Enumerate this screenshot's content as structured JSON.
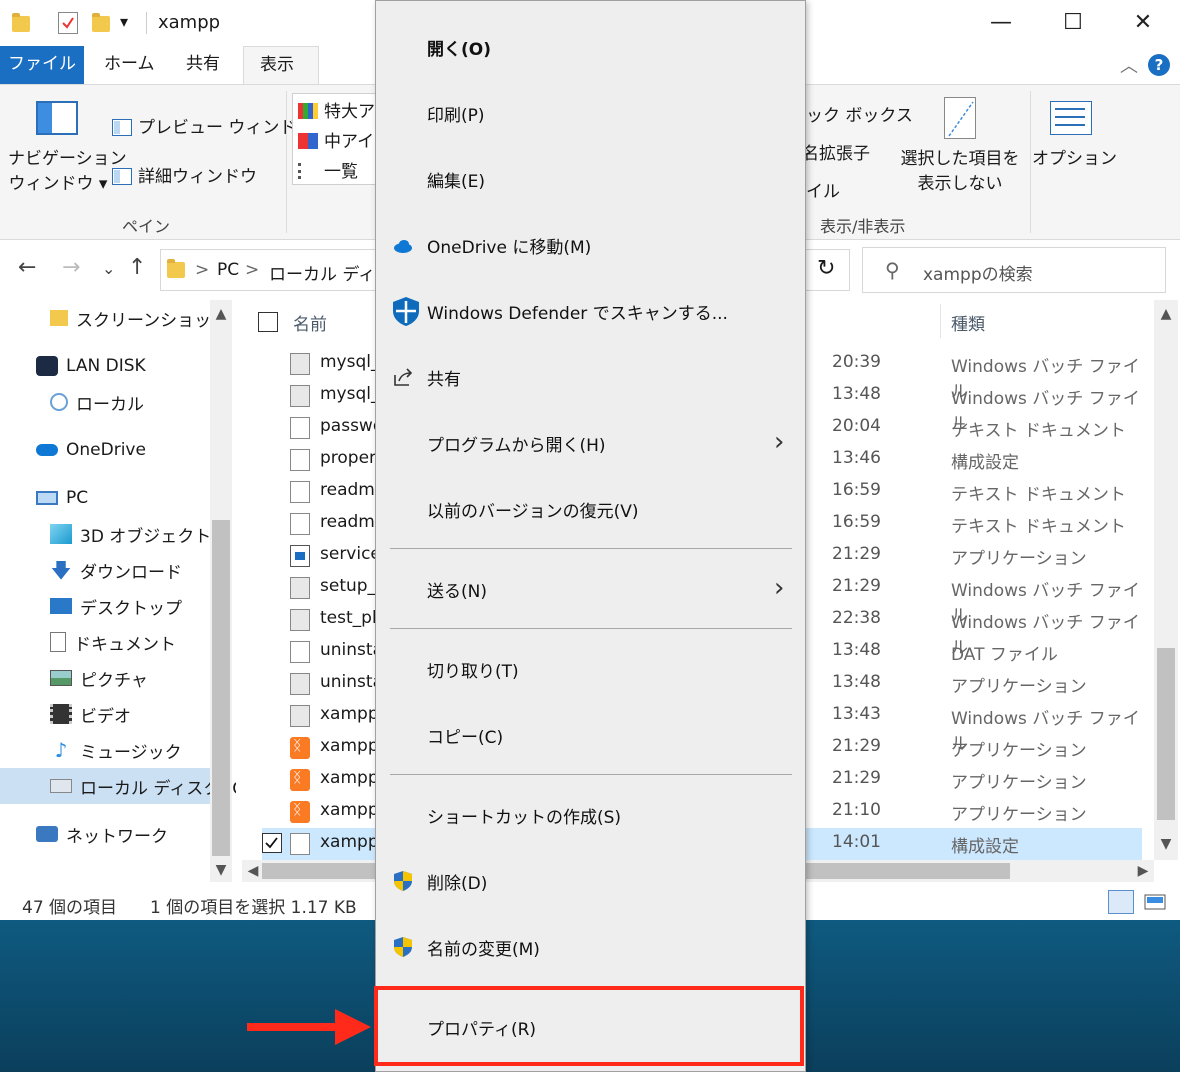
{
  "window": {
    "title": "xampp",
    "qat_dropdown": "▾",
    "controls": {
      "minimize": "—",
      "maximize": "☐",
      "close": "✕"
    }
  },
  "tabs": [
    {
      "label": "ファイル"
    },
    {
      "label": "ホーム"
    },
    {
      "label": "共有"
    },
    {
      "label": "表示"
    }
  ],
  "ribbon": {
    "nav_pane_line1": "ナビゲーション",
    "nav_pane_line2": "ウィンドウ ▾",
    "preview_pane": "プレビュー ウィンドウ",
    "details_pane": "詳細ウィンドウ",
    "group_pane": "ペイン",
    "layout_extra_large": "特大ア",
    "layout_medium": "中アイ",
    "layout_list": "一覧",
    "checkbox_partial": "ック ボックス",
    "ext_partial": "名拡張子",
    "hidden_partial": "イル",
    "hide_selected_line1": "選択した項目を",
    "hide_selected_line2": "表示しない",
    "options": "オプション",
    "group_show_hide": "表示/非表示"
  },
  "address": {
    "back": "←",
    "forward": "→",
    "recent": "⌄",
    "up": "↑",
    "sep1": ">",
    "crumb_pc": "PC",
    "sep2": ">",
    "crumb_disk": "ローカル ディスク",
    "refresh": "↻",
    "search_placeholder": "xamppの検索"
  },
  "nav_pane": {
    "items": [
      {
        "label": "スクリーンショット"
      },
      {
        "label": "LAN DISK"
      },
      {
        "label": "ローカル"
      },
      {
        "label": "OneDrive"
      },
      {
        "label": "PC"
      },
      {
        "label": "3D オブジェクト"
      },
      {
        "label": "ダウンロード"
      },
      {
        "label": "デスクトップ"
      },
      {
        "label": "ドキュメント"
      },
      {
        "label": "ピクチャ"
      },
      {
        "label": "ビデオ"
      },
      {
        "label": "ミュージック"
      },
      {
        "label": "ローカル ディスク (C"
      },
      {
        "label": "ネットワーク"
      }
    ]
  },
  "file_list": {
    "col_name": "名前",
    "col_type": "種類",
    "rows": [
      {
        "name": "mysql_",
        "date": "20:39",
        "type": "Windows バッチ ファイル",
        "icon": "bat"
      },
      {
        "name": "mysql_",
        "date": "13:48",
        "type": "Windows バッチ ファイル",
        "icon": "bat"
      },
      {
        "name": "passwo",
        "date": "20:04",
        "type": "テキスト ドキュメント",
        "icon": "doc"
      },
      {
        "name": "proper",
        "date": "13:46",
        "type": "構成設定",
        "icon": "cfg"
      },
      {
        "name": "readme",
        "date": "16:59",
        "type": "テキスト ドキュメント",
        "icon": "doc"
      },
      {
        "name": "readme",
        "date": "16:59",
        "type": "テキスト ドキュメント",
        "icon": "doc"
      },
      {
        "name": "service.",
        "date": "21:29",
        "type": "アプリケーション",
        "icon": "exe"
      },
      {
        "name": "setup_x",
        "date": "21:29",
        "type": "Windows バッチ ファイル",
        "icon": "bat"
      },
      {
        "name": "test_ph",
        "date": "22:38",
        "type": "Windows バッチ ファイル",
        "icon": "bat"
      },
      {
        "name": "uninsta",
        "date": "13:48",
        "type": "DAT ファイル",
        "icon": "doc"
      },
      {
        "name": "uninsta",
        "date": "13:48",
        "type": "アプリケーション",
        "icon": "uninst"
      },
      {
        "name": "xampp",
        "date": "13:43",
        "type": "Windows バッチ ファイル",
        "icon": "bat"
      },
      {
        "name": "xampp",
        "date": "21:29",
        "type": "アプリケーション",
        "icon": "xampp"
      },
      {
        "name": "xampp",
        "date": "21:29",
        "type": "アプリケーション",
        "icon": "xampp"
      },
      {
        "name": "xampp",
        "date": "21:10",
        "type": "アプリケーション",
        "icon": "xampp"
      },
      {
        "name": "xampp",
        "date": "14:01",
        "type": "構成設定",
        "icon": "cfg",
        "selected": true
      }
    ]
  },
  "status_bar": {
    "item_count": "47 個の項目",
    "selection": "1 個の項目を選択  1.17 KB"
  },
  "context_menu": {
    "open": "開く(O)",
    "print": "印刷(P)",
    "edit": "編集(E)",
    "onedrive_move": "OneDrive に移動(M)",
    "defender_scan": "Windows Defender でスキャンする...",
    "share": "共有",
    "open_with": "プログラムから開く(H)",
    "restore_versions": "以前のバージョンの復元(V)",
    "send_to": "送る(N)",
    "cut": "切り取り(T)",
    "copy": "コピー(C)",
    "create_shortcut": "ショートカットの作成(S)",
    "delete": "削除(D)",
    "rename": "名前の変更(M)",
    "properties": "プロパティ(R)",
    "chevron": "›"
  },
  "colors": {
    "accent": "#1a6fc2",
    "highlight": "#ff2a1a",
    "selection": "#cce8ff"
  }
}
